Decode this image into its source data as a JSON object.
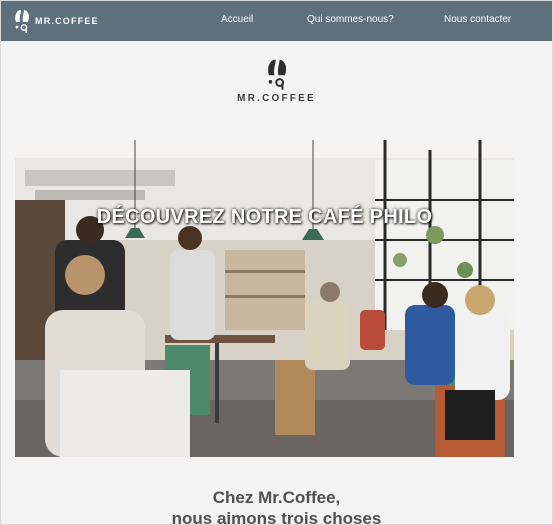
{
  "header": {
    "logo_wordmark": "MR.COFFEE",
    "nav": [
      {
        "label": "Accueil"
      },
      {
        "label": "Qui sommes-nous?"
      },
      {
        "label": "Nous contacter"
      }
    ],
    "background": "#5f707d"
  },
  "brand": {
    "wordmark": "MR.COFFEE"
  },
  "hero": {
    "title": "DÉCOUVREZ NOTRE CAFÉ PHILO"
  },
  "section": {
    "title_line1": "Chez Mr.Coffee,",
    "title_line2": "nous aimons trois choses"
  }
}
